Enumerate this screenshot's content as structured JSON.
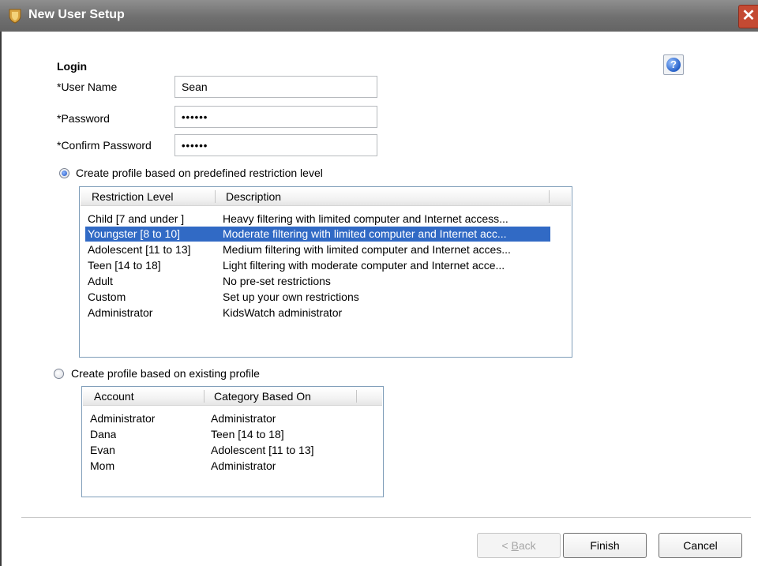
{
  "window": {
    "title": "New User Setup",
    "close_glyph": "✕"
  },
  "help": {
    "glyph": "?"
  },
  "login": {
    "heading": "Login",
    "user_name_label": "*User Name",
    "user_name_value": "Sean",
    "password_label": "*Password",
    "password_value": "••••••",
    "confirm_label": "*Confirm Password",
    "confirm_value": "••••••"
  },
  "option_predefined": {
    "label": "Create profile based on predefined restriction level",
    "selected": true,
    "columns": [
      "Restriction Level",
      "Description"
    ],
    "rows": [
      {
        "level": "Child [7 and under ]",
        "description": "Heavy filtering with limited computer and Internet access...",
        "selected": false
      },
      {
        "level": "Youngster [8 to 10]",
        "description": "Moderate filtering with limited computer and Internet acc...",
        "selected": true
      },
      {
        "level": "Adolescent [11 to 13]",
        "description": "Medium filtering with limited computer and Internet acces...",
        "selected": false
      },
      {
        "level": "Teen [14 to 18]",
        "description": "Light filtering with moderate computer and Internet acce...",
        "selected": false
      },
      {
        "level": "Adult",
        "description": "No pre-set restrictions",
        "selected": false
      },
      {
        "level": "Custom",
        "description": "Set up your own restrictions",
        "selected": false
      },
      {
        "level": "Administrator",
        "description": "KidsWatch administrator",
        "selected": false
      }
    ]
  },
  "option_existing": {
    "label": "Create profile based on existing profile",
    "selected": false,
    "columns": [
      "Account",
      "Category Based On"
    ],
    "rows": [
      {
        "account": "Administrator",
        "category": "Administrator"
      },
      {
        "account": "Dana",
        "category": "Teen [14 to 18]"
      },
      {
        "account": "Evan",
        "category": "Adolescent [11 to 13]"
      },
      {
        "account": "Mom",
        "category": "Administrator"
      }
    ]
  },
  "buttons": {
    "back_prefix": "< ",
    "back_mnemonic": "B",
    "back_rest": "ack",
    "finish": "Finish",
    "cancel": "Cancel"
  },
  "colors": {
    "selection": "#316ac5",
    "titlebar": "#6f6f6f",
    "close": "#c44a33"
  },
  "icons": {
    "app": "shield-icon",
    "help": "help-icon",
    "close": "close-icon"
  }
}
